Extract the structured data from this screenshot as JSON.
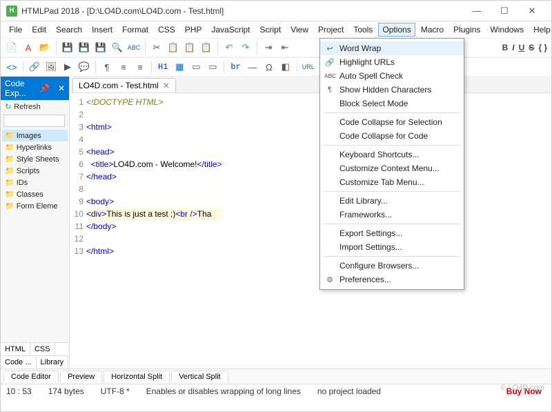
{
  "titlebar": {
    "app_name": "HTMLPad 2018",
    "file_path": "[D:\\LO4D.com\\LO4D.com - Test.html]"
  },
  "winbtns": {
    "min": "—",
    "max": "☐",
    "close": "✕"
  },
  "menubar": [
    "File",
    "Edit",
    "Search",
    "Insert",
    "Format",
    "CSS",
    "PHP",
    "JavaScript",
    "Script",
    "View",
    "Project",
    "Tools",
    "Options",
    "Macro",
    "Plugins",
    "Windows",
    "Help"
  ],
  "menu_open_index": 12,
  "toolbar2": {
    "h1": "H1",
    "br": "br"
  },
  "dropdown": [
    {
      "type": "item",
      "label": "Word Wrap",
      "icon": "↩",
      "hl": true
    },
    {
      "type": "item",
      "label": "Highlight URLs",
      "icon": "🔗"
    },
    {
      "type": "item",
      "label": "Auto Spell Check",
      "icon": "ᴀʙᴄ"
    },
    {
      "type": "item",
      "label": "Show Hidden Characters",
      "icon": "¶"
    },
    {
      "type": "item",
      "label": "Block Select Mode"
    },
    {
      "type": "divider"
    },
    {
      "type": "item",
      "label": "Code Collapse for Selection"
    },
    {
      "type": "item",
      "label": "Code Collapse for Code"
    },
    {
      "type": "divider"
    },
    {
      "type": "item",
      "label": "Keyboard Shortcuts..."
    },
    {
      "type": "item",
      "label": "Customize Context Menu..."
    },
    {
      "type": "item",
      "label": "Customize Tab Menu..."
    },
    {
      "type": "divider"
    },
    {
      "type": "item",
      "label": "Edit Library..."
    },
    {
      "type": "item",
      "label": "Frameworks..."
    },
    {
      "type": "divider"
    },
    {
      "type": "item",
      "label": "Export Settings..."
    },
    {
      "type": "item",
      "label": "Import Settings..."
    },
    {
      "type": "divider"
    },
    {
      "type": "item",
      "label": "Configure Browsers..."
    },
    {
      "type": "item",
      "label": "Preferences...",
      "icon": "⚙"
    }
  ],
  "sidebar": {
    "title": "Code Exp...",
    "pin": "📌",
    "close": "✕",
    "refresh": "Refresh",
    "search_placeholder": "",
    "items": [
      "Images",
      "Hyperlinks",
      "Style Sheets",
      "Scripts",
      "IDs",
      "Classes",
      "Form Eleme"
    ],
    "tabs1": [
      "HTML",
      "CSS"
    ],
    "tabs2": [
      "Code ...",
      "Library"
    ]
  },
  "editor": {
    "tab_label": "LO4D.com - Test.html",
    "lines": [
      {
        "num": 1,
        "parts": [
          {
            "cls": "c-doctype",
            "t": "<!DOCTYPE HTML>"
          }
        ]
      },
      {
        "num": 2,
        "parts": []
      },
      {
        "num": 3,
        "parts": [
          {
            "cls": "c-tag",
            "t": "<html>"
          }
        ]
      },
      {
        "num": 4,
        "parts": []
      },
      {
        "num": 5,
        "parts": [
          {
            "cls": "c-tag",
            "t": "<head>"
          }
        ]
      },
      {
        "num": 6,
        "parts": [
          {
            "cls": "",
            "t": "  "
          },
          {
            "cls": "c-tag",
            "t": "<title>"
          },
          {
            "cls": "c-text",
            "t": "LO4D.com - Welcome!"
          },
          {
            "cls": "c-tag",
            "t": "</title>"
          }
        ]
      },
      {
        "num": 7,
        "parts": [
          {
            "cls": "c-tag",
            "t": "</head>"
          }
        ]
      },
      {
        "num": 8,
        "parts": []
      },
      {
        "num": 9,
        "parts": [
          {
            "cls": "c-tag",
            "t": "<body>"
          }
        ]
      },
      {
        "num": 10,
        "hl": true,
        "parts": [
          {
            "cls": "c-tag",
            "t": "<div>"
          },
          {
            "cls": "c-text",
            "t": "This is just a test ;)"
          },
          {
            "cls": "c-tag",
            "t": "<br />"
          },
          {
            "cls": "c-text",
            "t": "Tha"
          }
        ]
      },
      {
        "num": 11,
        "parts": [
          {
            "cls": "c-tag",
            "t": "</body>"
          }
        ]
      },
      {
        "num": 12,
        "parts": []
      },
      {
        "num": 13,
        "parts": [
          {
            "cls": "c-tag",
            "t": "</html>"
          }
        ]
      }
    ]
  },
  "footer_tabs": [
    "Code Editor",
    "Preview",
    "Horizontal Split",
    "Vertical Split"
  ],
  "status": {
    "pos": "10 : 53",
    "bytes": "174 bytes",
    "encoding": "UTF-8 *",
    "hint": "Enables or disables wrapping of long lines",
    "project": "no project loaded",
    "buy": "Buy Now"
  },
  "fmt_icons": {
    "b": "B",
    "i": "I",
    "u": "U",
    "s": "S"
  },
  "watermark": "© LO4D.com"
}
